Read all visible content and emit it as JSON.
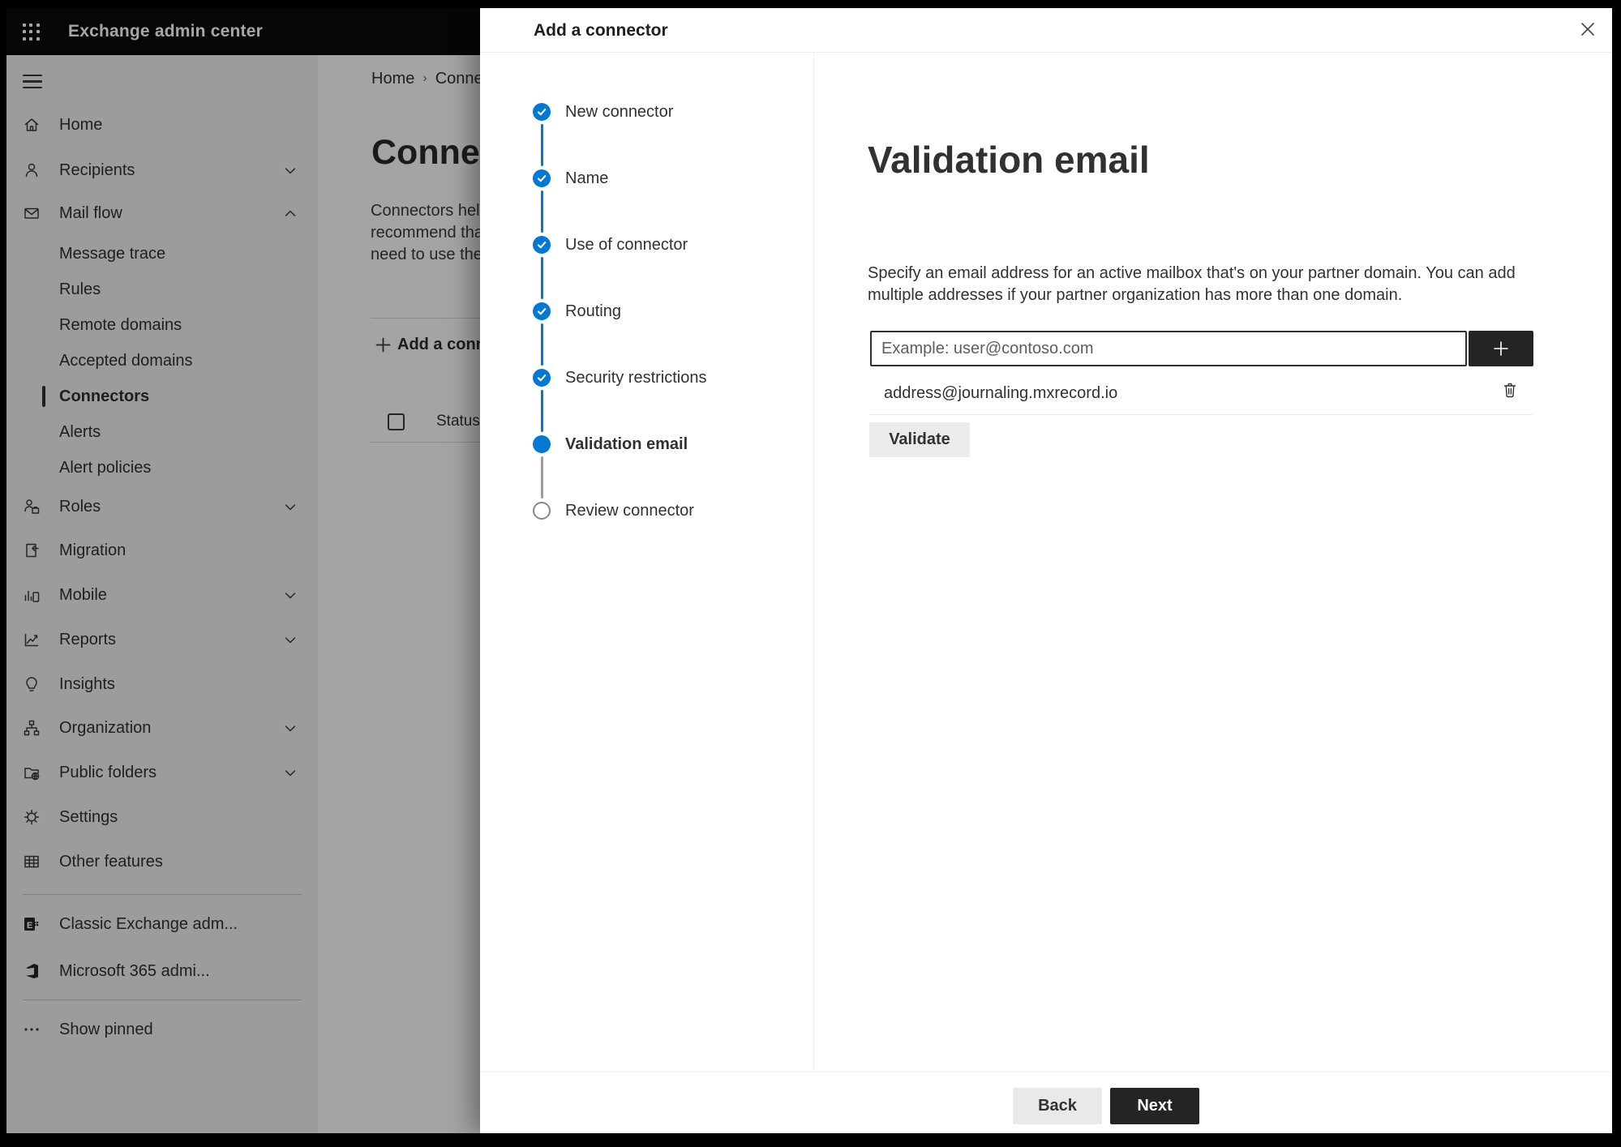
{
  "header": {
    "title": "Exchange admin center"
  },
  "sidebar": {
    "items": [
      {
        "label": "Home",
        "icon": "home-icon"
      },
      {
        "label": "Recipients",
        "icon": "person-icon",
        "chevron": "down"
      },
      {
        "label": "Mail flow",
        "icon": "mail-icon",
        "chevron": "up"
      },
      {
        "label": "Message trace",
        "sub": true
      },
      {
        "label": "Rules",
        "sub": true
      },
      {
        "label": "Remote domains",
        "sub": true
      },
      {
        "label": "Accepted domains",
        "sub": true
      },
      {
        "label": "Connectors",
        "sub": true,
        "active": true
      },
      {
        "label": "Alerts",
        "sub": true
      },
      {
        "label": "Alert policies",
        "sub": true
      },
      {
        "label": "Roles",
        "icon": "roles-icon",
        "chevron": "down"
      },
      {
        "label": "Migration",
        "icon": "migration-icon"
      },
      {
        "label": "Mobile",
        "icon": "mobile-icon",
        "chevron": "down"
      },
      {
        "label": "Reports",
        "icon": "reports-icon",
        "chevron": "down"
      },
      {
        "label": "Insights",
        "icon": "lightbulb-icon"
      },
      {
        "label": "Organization",
        "icon": "org-icon",
        "chevron": "down"
      },
      {
        "label": "Public folders",
        "icon": "folder-globe-icon",
        "chevron": "down"
      },
      {
        "label": "Settings",
        "icon": "gear-icon"
      },
      {
        "label": "Other features",
        "icon": "grid-icon"
      },
      {
        "label": "Classic Exchange adm...",
        "icon": "exchange-logo-icon"
      },
      {
        "label": "Microsoft 365 admi...",
        "icon": "office-logo-icon"
      },
      {
        "label": "Show pinned",
        "icon": "ellipsis-icon"
      }
    ]
  },
  "background_page": {
    "breadcrumb": [
      "Home",
      "Conne"
    ],
    "heading": "Connec",
    "paragraph": [
      "Connectors help",
      "recommend that",
      "need to use ther"
    ],
    "add_button": "Add a conn",
    "table": {
      "status_header": "Status"
    }
  },
  "panel": {
    "title": "Add a connector",
    "steps": [
      {
        "label": "New connector",
        "state": "completed"
      },
      {
        "label": "Name",
        "state": "completed"
      },
      {
        "label": "Use of connector",
        "state": "completed"
      },
      {
        "label": "Routing",
        "state": "completed"
      },
      {
        "label": "Security restrictions",
        "state": "completed"
      },
      {
        "label": "Validation email",
        "state": "current"
      },
      {
        "label": "Review connector",
        "state": "upcoming"
      }
    ],
    "content": {
      "title": "Validation email",
      "description": "Specify an email address for an active mailbox that's on your partner domain. You can add multiple addresses if your partner organization has more than one domain.",
      "email_input": {
        "value": "",
        "placeholder": "Example: user@contoso.com"
      },
      "addresses": [
        {
          "email": "address@journaling.mxrecord.io"
        }
      ],
      "validate_button": "Validate"
    },
    "footer": {
      "back_button": "Back",
      "next_button": "Next"
    }
  },
  "colors": {
    "accent_blue": "#0078d4",
    "dark_button": "#252423",
    "panel_text": "#323130",
    "placeholder_gray": "#605e5c",
    "divider": "#edebe9",
    "upcoming_step_gray": "#8a8886"
  }
}
